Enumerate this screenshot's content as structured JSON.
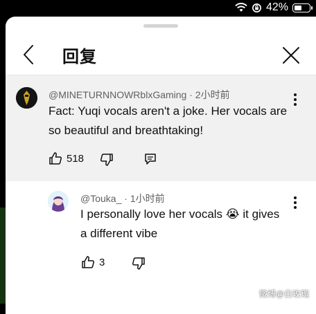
{
  "status": {
    "battery": "42%"
  },
  "header": {
    "title": "回复"
  },
  "comment": {
    "author": "@MINETURNNOWRblxGaming",
    "separator": "·",
    "time": "2小时前",
    "text": "Fact: Yuqi vocals aren't a joke. Her vocals are so beautiful and breathtaking!",
    "likes": "518"
  },
  "reply": {
    "author": "@Touka_",
    "separator": "·",
    "time": "1小时前",
    "text": "I personally love her vocals 😭 it gives a different vibe",
    "likes": "3"
  },
  "watermark": "微博@白玫瑰"
}
